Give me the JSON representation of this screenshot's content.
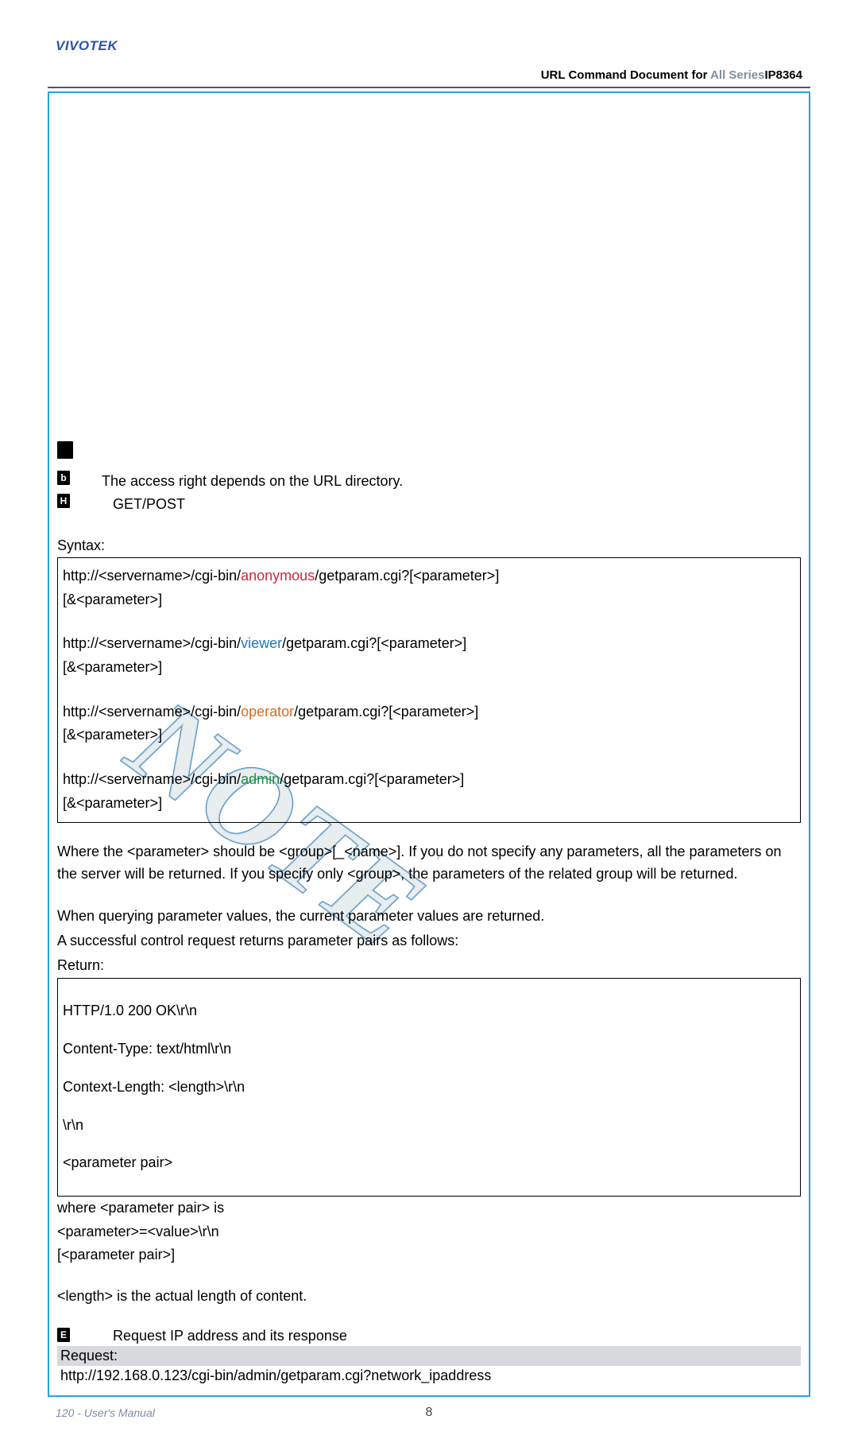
{
  "brand": "VIVOTEK",
  "docHeader": {
    "prefix": "URL Command Document for",
    "mid": "All Series",
    "suffix": "IP8364"
  },
  "bullets": {
    "security": "The access right depends on the URL directory.",
    "method": "GET/POST"
  },
  "sections": {
    "syntaxLabel": "Syntax:",
    "returnLabel": "Return:",
    "requestLabel": "Request:",
    "exampleLabel": "Request IP address and its response"
  },
  "syntax": {
    "line1a": "http://<servername>/cgi-bin/",
    "role1": "anonymous",
    "line1b": "/getparam.cgi?[<parameter>]",
    "line1c": "[&<parameter>]",
    "line2a": "http://<servername>/cgi-bin/",
    "role2": "viewer",
    "line2b": "/getparam.cgi?[<parameter>]",
    "line2c": "[&<parameter>]",
    "line3a": "http://<servername>/cgi-bin/",
    "role3": "operator",
    "line3b": "/getparam.cgi?[<parameter>]",
    "line3c": "[&<parameter>]",
    "line4a": "http://<servername>/cgi-bin/",
    "role4": "admin",
    "line4b": "/getparam.cgi?[<parameter>]",
    "line4c": "[&<parameter>]"
  },
  "paragraphs": {
    "p1": "Where the <parameter> should be <group>[_<name>]. If you do not specify any parameters, all the parameters on the server will be returned. If you specify only <group>, the parameters of the related group will be returned.",
    "p2": "When querying parameter values, the current parameter values are returned.",
    "p3": "A successful control request returns parameter pairs as follows:"
  },
  "returnBox": {
    "r1": "HTTP/1.0 200 OK\\r\\n",
    "r2": "Content-Type: text/html\\r\\n",
    "r3": "Context-Length: <length>\\r\\n",
    "r4": "\\r\\n",
    "r5": "<parameter pair>"
  },
  "afterReturn": {
    "a1": "where <parameter pair> is",
    "a2": "<parameter>=<value>\\r\\n",
    "a3": "[<parameter pair>]",
    "a4": "<length> is the actual length of content."
  },
  "request": {
    "url": "http://192.168.0.123/cgi-bin/admin/getparam.cgi?network_ipaddress"
  },
  "footer": {
    "left": "120 - User's Manual",
    "pageNum": "8"
  }
}
